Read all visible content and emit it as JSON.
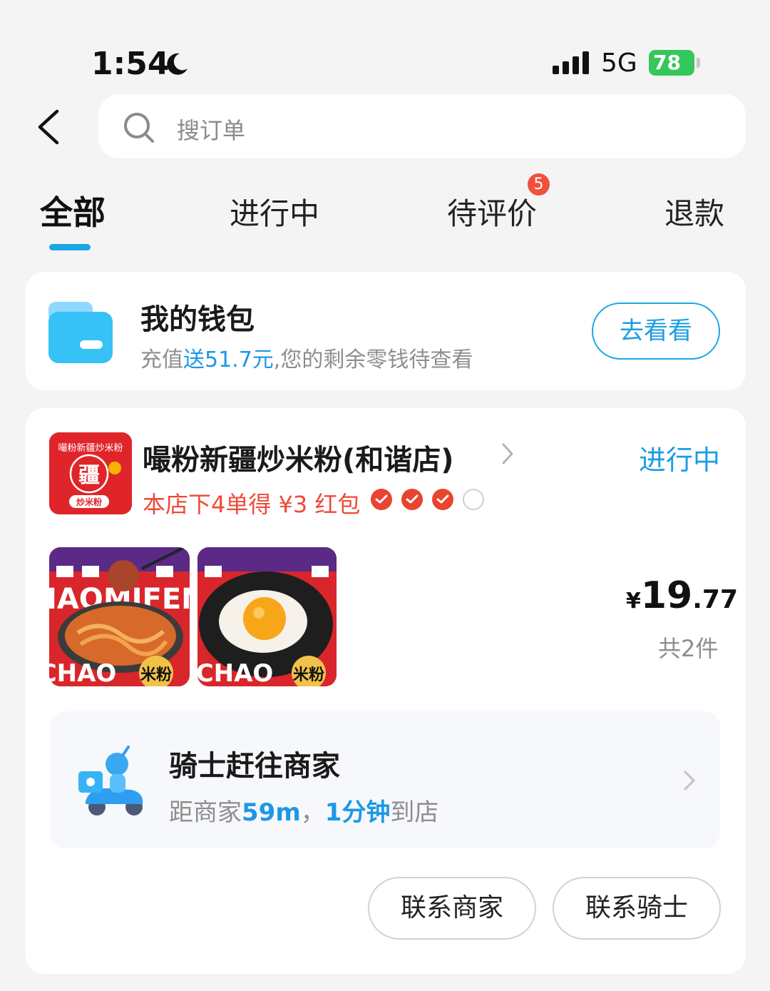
{
  "status_bar": {
    "time": "1:54",
    "network": "5G",
    "battery": "78"
  },
  "search": {
    "placeholder": "搜订单"
  },
  "tabs": [
    {
      "label": "全部",
      "active": true
    },
    {
      "label": "进行中"
    },
    {
      "label": "待评价",
      "badge": "5"
    },
    {
      "label": "退款"
    }
  ],
  "wallet": {
    "title": "我的钱包",
    "sub_prefix": "充值",
    "sub_highlight": "送51.7元",
    "sub_suffix": ",您的剩余零钱待查看",
    "button": "去看看"
  },
  "order": {
    "shop_name": "嘬粉新疆炒米粉(和谐店)",
    "status": "进行中",
    "promo": "本店下4单得 ¥3 红包",
    "promo_progress": {
      "completed": 3,
      "total": 4
    },
    "currency": "¥",
    "price_int": "19",
    "price_dec": ".77",
    "count": "共2件",
    "rider_title": "骑士赶往商家",
    "rider_prefix": "距商家",
    "rider_distance": "59m",
    "rider_sep": "，",
    "rider_eta": "1分钟",
    "rider_suffix": "到店",
    "buttons": {
      "contact_shop": "联系商家",
      "contact_rider": "联系骑士"
    },
    "logo_text": {
      "top": "嘬粉新疆炒米粉",
      "center": "疆",
      "bottom": "炒米粉"
    },
    "thumb_text": {
      "top": "HAOMIFEN",
      "bottom": "CHAO",
      "stamp": "米粉"
    }
  },
  "colors": {
    "accent": "#1aa6e8",
    "promo": "#ee4a37",
    "badge": "#f1503d",
    "battery": "#34c759"
  }
}
